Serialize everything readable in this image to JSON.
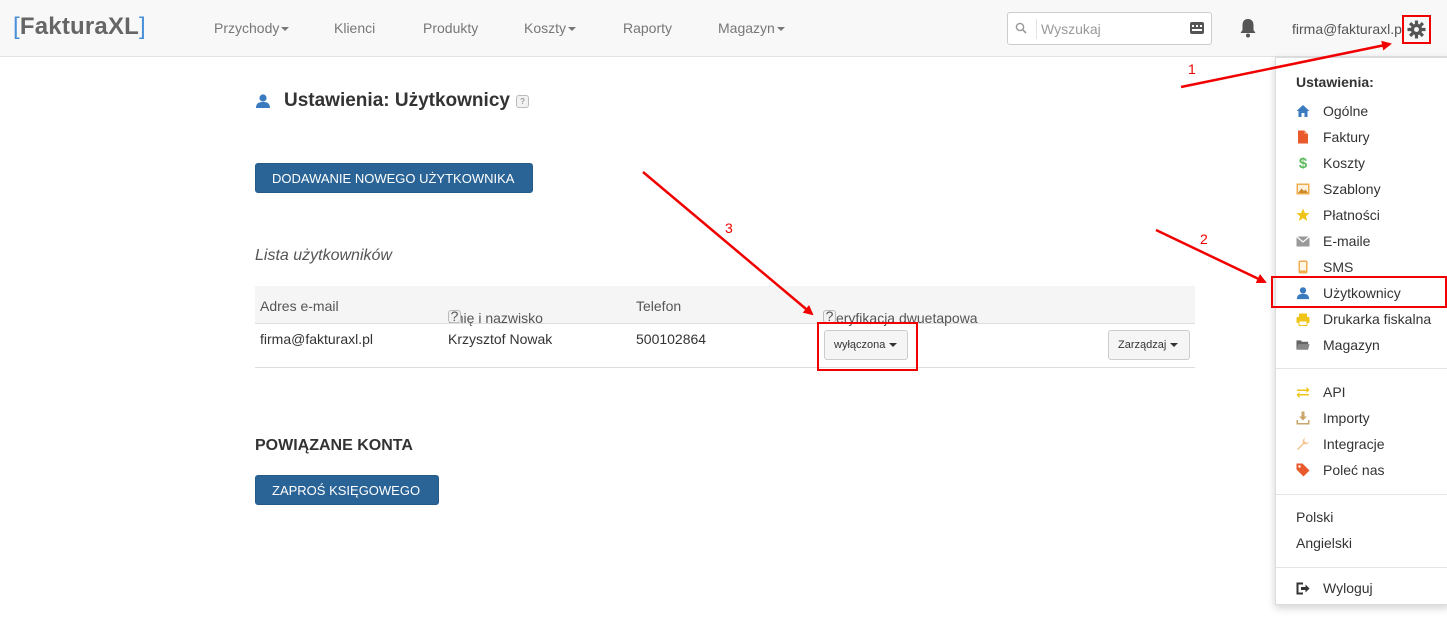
{
  "navbar": {
    "logo_open": "[",
    "logo_text": "FakturaXL",
    "logo_close": "]",
    "menu": [
      {
        "label": "Przychody",
        "caret": true
      },
      {
        "label": "Klienci",
        "caret": false
      },
      {
        "label": "Produkty",
        "caret": false
      },
      {
        "label": "Koszty",
        "caret": true
      },
      {
        "label": "Raporty",
        "caret": false
      },
      {
        "label": "Magazyn",
        "caret": true
      }
    ],
    "search_placeholder": "Wyszukaj",
    "user_email": "firma@fakturaxl.pl"
  },
  "page": {
    "title": "Ustawienia: Użytkownicy",
    "help": "?",
    "add_user_button": "DODAWANIE NOWEGO UŻYTKOWNIKA",
    "list_title": "Lista użytkowników",
    "columns": {
      "email": "Adres e-mail",
      "name": "Imię i nazwisko",
      "phone": "Telefon",
      "twofa": "Weryfikacja dwuetapowa"
    },
    "row": {
      "email": "firma@fakturaxl.pl",
      "name": "Krzysztof Nowak",
      "phone": "500102864",
      "twofa_value": "wyłączona",
      "manage": "Zarządzaj"
    },
    "linked_title": "POWIĄZANE KONTA",
    "invite_button": "ZAPROŚ KSIĘGOWEGO"
  },
  "dropdown": {
    "header": "Ustawienia:",
    "items": [
      {
        "label": "Ogólne",
        "icon": "home-icon"
      },
      {
        "label": "Faktury",
        "icon": "file-icon"
      },
      {
        "label": "Koszty",
        "icon": "dollar-icon"
      },
      {
        "label": "Szablony",
        "icon": "picture-icon"
      },
      {
        "label": "Płatności",
        "icon": "star-icon"
      },
      {
        "label": "E-maile",
        "icon": "envelope-icon"
      },
      {
        "label": "SMS",
        "icon": "phone-icon"
      },
      {
        "label": "Użytkownicy",
        "icon": "user-icon"
      },
      {
        "label": "Drukarka fiskalna",
        "icon": "printer-icon"
      },
      {
        "label": "Magazyn",
        "icon": "folder-icon"
      }
    ],
    "items2": [
      {
        "label": "API",
        "icon": "transfer-icon"
      },
      {
        "label": "Importy",
        "icon": "download-icon"
      },
      {
        "label": "Integracje",
        "icon": "wrench-icon"
      },
      {
        "label": "Poleć nas",
        "icon": "tag-icon"
      }
    ],
    "languages": [
      "Polski",
      "Angielski"
    ],
    "logout": "Wyloguj"
  },
  "annotations": {
    "a1": "1",
    "a2": "2",
    "a3": "3"
  },
  "colors": {
    "primary_button": "#2a6496",
    "highlight": "#f10000",
    "logo_bracket": "#4a90d9"
  }
}
